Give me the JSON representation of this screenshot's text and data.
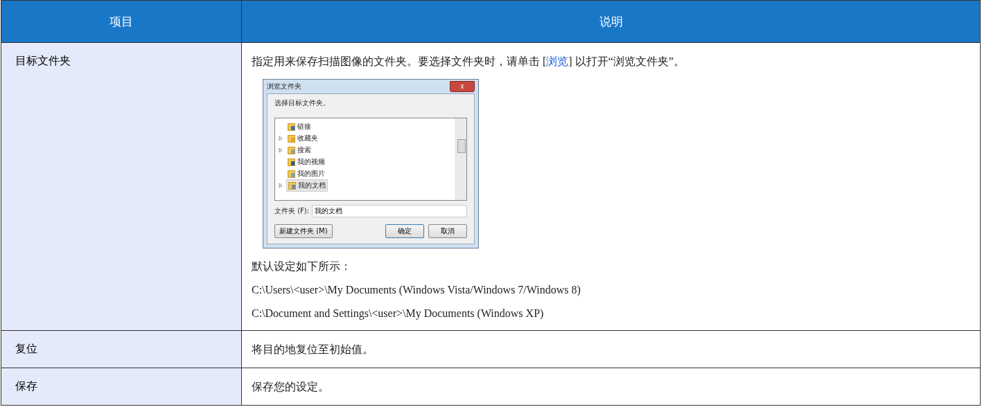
{
  "table": {
    "columns": [
      "项目",
      "说明"
    ],
    "rows": [
      {
        "item": "目标文件夹",
        "description": {
          "text_before": "指定用来保存扫描图像的文件夹。要选择文件夹时，请单击 [",
          "link": "浏览",
          "text_after": "] 以打开“浏览文件夹”。"
        },
        "dialog": {
          "title": "浏览文件夹",
          "close": "x",
          "prompt": "选择目标文件夹。",
          "tree": [
            {
              "label": "链接",
              "kind": "link",
              "expandable": false,
              "selected": false
            },
            {
              "label": "收藏夹",
              "kind": "star",
              "expandable": true,
              "selected": false
            },
            {
              "label": "搜索",
              "kind": "search",
              "expandable": true,
              "selected": false
            },
            {
              "label": "我的视频",
              "kind": "video",
              "expandable": false,
              "selected": false
            },
            {
              "label": "我的图片",
              "kind": "picture",
              "expandable": false,
              "selected": false
            },
            {
              "label": "我的文档",
              "kind": "document",
              "expandable": true,
              "selected": true
            }
          ],
          "folder_label": "文件夹 (F):",
          "folder_value": "我的文档",
          "buttons": [
            {
              "label": "新建文件夹 (M)",
              "kind": "left"
            },
            {
              "label": "确定",
              "kind": "default"
            },
            {
              "label": "取消",
              "kind": "normal"
            }
          ]
        },
        "notes": [
          "默认设定如下所示：",
          "C:\\Users\\<user>\\My Documents (Windows Vista/Windows 7/Windows 8)",
          "C:\\Document and Settings\\<user>\\My Documents (Windows XP)"
        ]
      },
      {
        "item": "复位",
        "description": {
          "text_before": "将目的地复位至初始值。"
        }
      },
      {
        "item": "保存",
        "description": {
          "text_before": "保存您的设定。"
        }
      }
    ]
  }
}
